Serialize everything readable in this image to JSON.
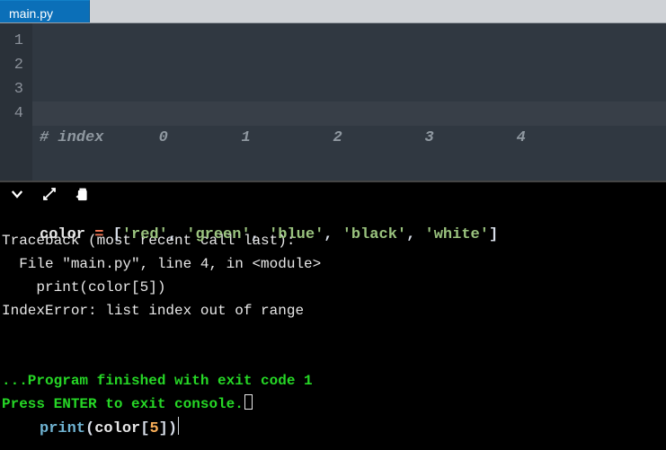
{
  "tab": {
    "filename": "main.py"
  },
  "editor": {
    "line_numbers": [
      "1",
      "2",
      "3",
      "4"
    ],
    "line1": {
      "hash": "#",
      "word_index": " index",
      "n0": "0",
      "n1": "1",
      "n2": "2",
      "n3": "3",
      "n4": "4"
    },
    "line2": {
      "ident": "color",
      "eq": " = ",
      "lb": "[",
      "s0": "'red'",
      "c0": ", ",
      "s1": "'green'",
      "c1": ", ",
      "s2": "'blue'",
      "c2": ", ",
      "s3": "'black'",
      "c3": ", ",
      "s4": "'white'",
      "rb": "]"
    },
    "line4": {
      "fn": "print",
      "lp": "(",
      "var": "color",
      "lbr": "[",
      "idx": "5",
      "rbr": "]",
      "rp": ")"
    }
  },
  "console": {
    "l1": "Traceback (most recent call last):",
    "l2": "  File \"main.py\", line 4, in <module>",
    "l3": "    print(color[5])",
    "l4": "IndexError: list index out of range",
    "blank": "",
    "finished": "...Program finished with exit code 1",
    "prompt": "Press ENTER to exit console."
  },
  "colors": {
    "tab_bg": "#0b6fb8",
    "editor_bg": "#303841",
    "console_bg": "#000000",
    "success_green": "#26d726"
  }
}
